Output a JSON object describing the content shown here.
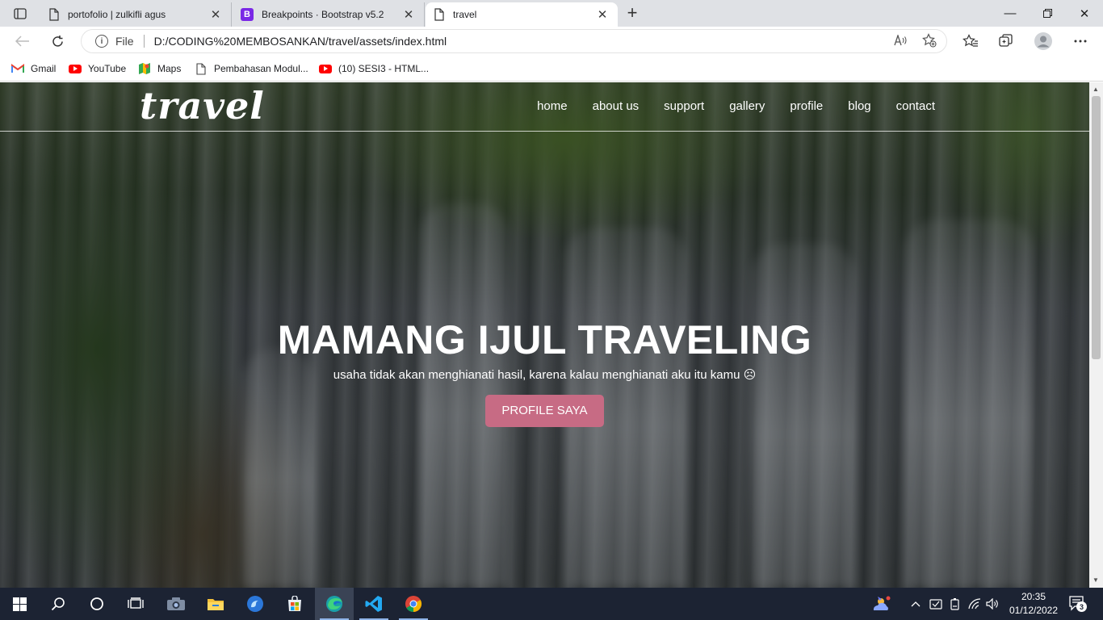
{
  "browser": {
    "tabs": [
      {
        "title": "portofolio | zulkifli agus",
        "icon": "page-icon",
        "active": false
      },
      {
        "title": "Breakpoints · Bootstrap v5.2",
        "icon": "bootstrap-icon",
        "favicon_letter": "B",
        "active": false
      },
      {
        "title": "travel",
        "icon": "page-icon",
        "active": true
      }
    ],
    "address": {
      "protocol": "File",
      "url": "D:/CODING%20MEMBOSANKAN/travel/assets/index.html",
      "read_aloud_label": "Aᴬ"
    },
    "bookmarks": [
      {
        "label": "Gmail",
        "icon": "gmail-icon"
      },
      {
        "label": "YouTube",
        "icon": "youtube-icon"
      },
      {
        "label": "Maps",
        "icon": "maps-icon"
      },
      {
        "label": "Pembahasan Modul...",
        "icon": "page-icon"
      },
      {
        "label": "(10) SESI3 - HTML...",
        "icon": "youtube-icon"
      }
    ]
  },
  "site": {
    "brand": "travel",
    "menu": [
      "home",
      "about us",
      "support",
      "gallery",
      "profile",
      "blog",
      "contact"
    ],
    "hero": {
      "title": "MAMANG IJUL TRAVELING",
      "subtitle": "usaha tidak akan menghianati hasil, karena kalau menghianati aku itu kamu ☹",
      "cta": "PROFILE SAYA"
    },
    "colors": {
      "cta": "#c76b84"
    }
  },
  "taskbar": {
    "time": "20:35",
    "date": "01/12/2022",
    "notification_count": "3"
  }
}
